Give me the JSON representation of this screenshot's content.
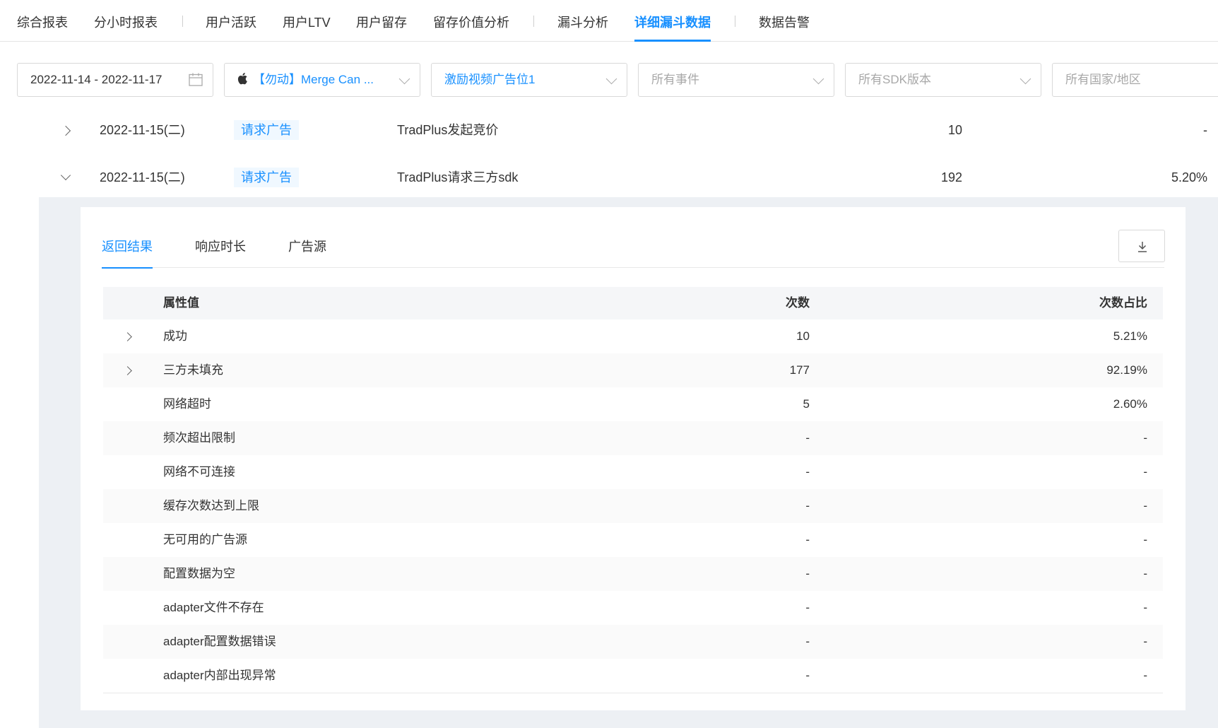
{
  "nav": {
    "items": [
      "综合报表",
      "分小时报表",
      "用户活跃",
      "用户LTV",
      "用户留存",
      "留存价值分析",
      "漏斗分析",
      "详细漏斗数据",
      "数据告警"
    ],
    "active": "详细漏斗数据"
  },
  "filters": {
    "date_range": "2022-11-14 - 2022-11-17",
    "app": "【勿动】Merge Can ...",
    "ad_slot": "激励视频广告位1",
    "event_placeholder": "所有事件",
    "sdk_placeholder": "所有SDK版本",
    "country_placeholder": "所有国家/地区"
  },
  "outer_rows": [
    {
      "date": "2022-11-15(二)",
      "tag": "请求广告",
      "event": "TradPlus发起竞价",
      "count": "10",
      "pct": "-"
    },
    {
      "date": "2022-11-15(二)",
      "tag": "请求广告",
      "event": "TradPlus请求三方sdk",
      "count": "192",
      "pct": "5.20%"
    }
  ],
  "detail": {
    "tabs": [
      "返回结果",
      "响应时长",
      "广告源"
    ],
    "active_tab": "返回结果",
    "columns": {
      "name": "属性值",
      "count": "次数",
      "pct": "次数占比"
    },
    "rows": [
      {
        "name": "成功",
        "count": "10",
        "pct": "5.21%",
        "expandable": true
      },
      {
        "name": "三方未填充",
        "count": "177",
        "pct": "92.19%",
        "expandable": true
      },
      {
        "name": "网络超时",
        "count": "5",
        "pct": "2.60%",
        "expandable": false
      },
      {
        "name": "频次超出限制",
        "count": "-",
        "pct": "-",
        "expandable": false
      },
      {
        "name": "网络不可连接",
        "count": "-",
        "pct": "-",
        "expandable": false
      },
      {
        "name": "缓存次数达到上限",
        "count": "-",
        "pct": "-",
        "expandable": false
      },
      {
        "name": "无可用的广告源",
        "count": "-",
        "pct": "-",
        "expandable": false
      },
      {
        "name": "配置数据为空",
        "count": "-",
        "pct": "-",
        "expandable": false
      },
      {
        "name": "adapter文件不存在",
        "count": "-",
        "pct": "-",
        "expandable": false
      },
      {
        "name": "adapter配置数据错误",
        "count": "-",
        "pct": "-",
        "expandable": false
      },
      {
        "name": "adapter内部出现异常",
        "count": "-",
        "pct": "-",
        "expandable": false
      }
    ]
  },
  "colors": {
    "accent": "#1890ff",
    "tag_bg": "#f0f8ff",
    "detail_bg": "#edf0f4"
  }
}
